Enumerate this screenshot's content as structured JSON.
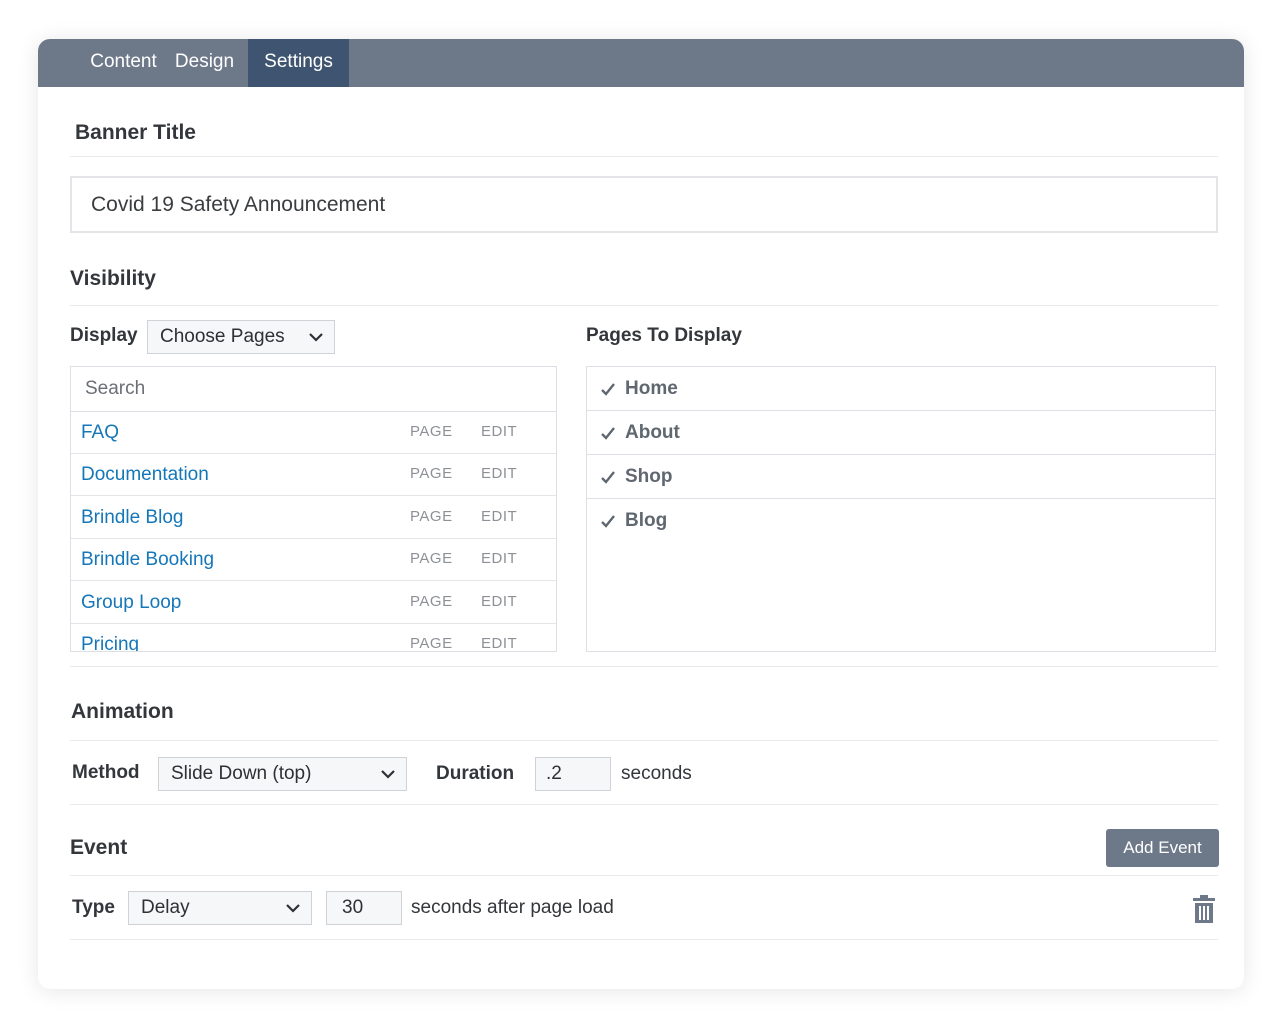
{
  "tabs": [
    {
      "label": "Content",
      "active": false
    },
    {
      "label": "Design",
      "active": false
    },
    {
      "label": "Settings",
      "active": true
    }
  ],
  "banner_title": {
    "heading": "Banner Title",
    "value": "Covid 19 Safety Announcement"
  },
  "visibility": {
    "heading": "Visibility",
    "display_label": "Display",
    "display_value": "Choose Pages",
    "pages_heading": "Pages To Display",
    "search_placeholder": "Search",
    "page_list": [
      {
        "name": "FAQ",
        "page": "PAGE",
        "edit": "EDIT"
      },
      {
        "name": "Documentation",
        "page": "PAGE",
        "edit": "EDIT"
      },
      {
        "name": "Brindle Blog",
        "page": "PAGE",
        "edit": "EDIT"
      },
      {
        "name": "Brindle Booking",
        "page": "PAGE",
        "edit": "EDIT"
      },
      {
        "name": "Group Loop",
        "page": "PAGE",
        "edit": "EDIT"
      },
      {
        "name": "Pricing",
        "page": "PAGE",
        "edit": "EDIT"
      }
    ],
    "selected_pages": [
      "Home",
      "About",
      "Shop",
      "Blog"
    ]
  },
  "animation": {
    "heading": "Animation",
    "method_label": "Method",
    "method_value": "Slide Down (top)",
    "duration_label": "Duration",
    "duration_value": ".2",
    "duration_unit": "seconds"
  },
  "event": {
    "heading": "Event",
    "add_button": "Add Event",
    "type_label": "Type",
    "type_value": "Delay",
    "delay_value": "30",
    "delay_suffix": "seconds after page load"
  },
  "colors": {
    "tab_bar": "#6d7889",
    "tab_active": "#3f5470",
    "link": "#1577b8",
    "button": "#6d7889"
  },
  "icons": [
    "chevron-down-icon",
    "check-icon",
    "trash-icon"
  ]
}
